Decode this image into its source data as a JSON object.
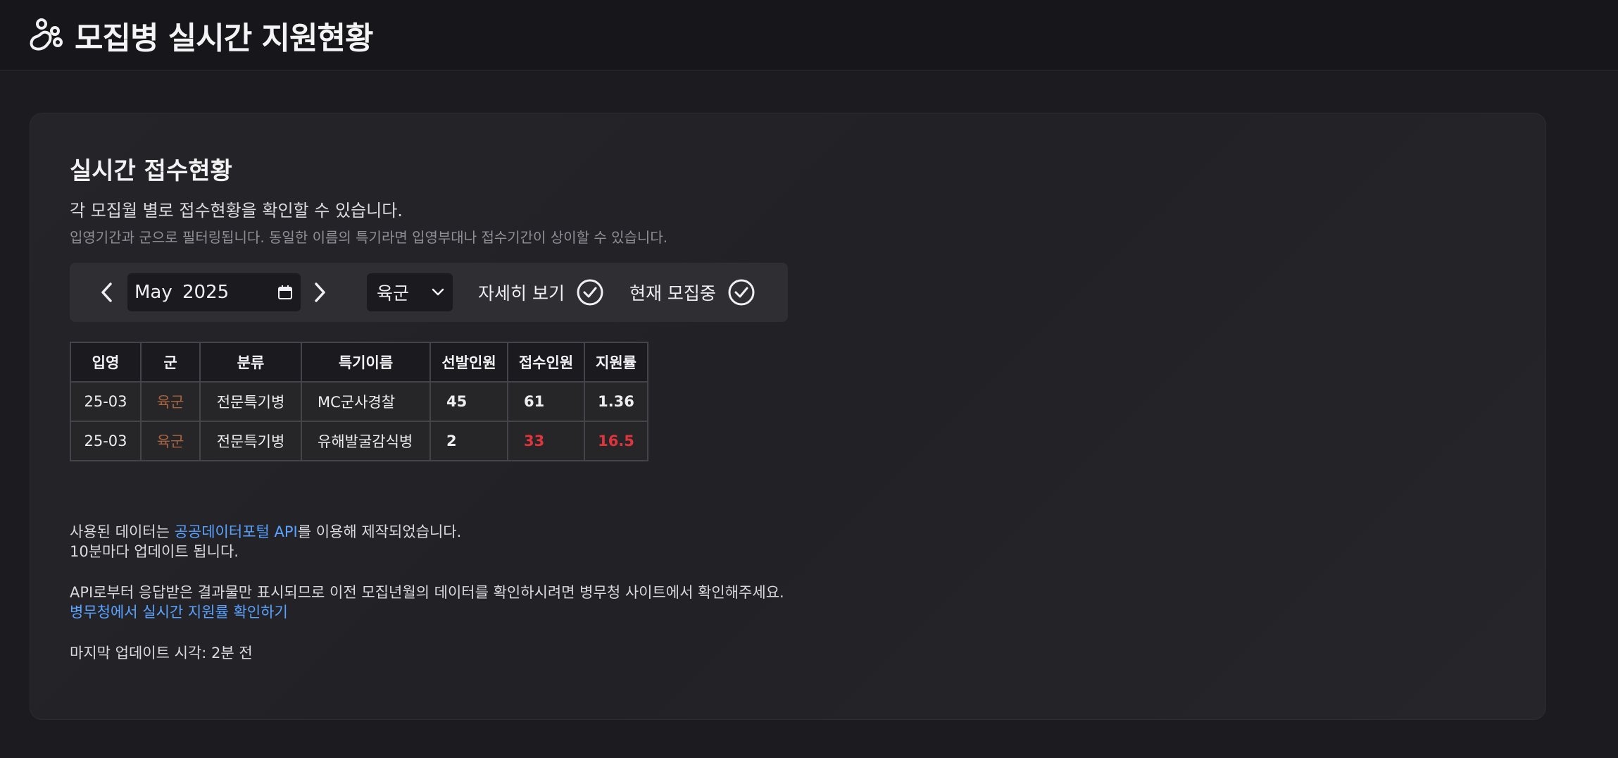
{
  "header": {
    "title": "모집병 실시간 지원현황",
    "logo_icon": "paw-icon"
  },
  "section": {
    "title": "실시간 접수현황",
    "subtitle": "각 모집월 별로 접수현황을 확인할 수 있습니다.",
    "hint": "입영기간과 군으로 필터링됩니다. 동일한 이름의 특기라면 입영부대나 접수기간이 상이할 수 있습니다."
  },
  "filters": {
    "month_value": "May 2025",
    "branch_value": "육군",
    "detail_label": "자세히 보기",
    "recruiting_label": "현재 모집중"
  },
  "table": {
    "headers": [
      "입영",
      "군",
      "분류",
      "특기이름",
      "선발인원",
      "접수인원",
      "지원률"
    ],
    "rows": [
      [
        "25-03",
        "육군",
        "전문특기병",
        "MC군사경찰",
        "45",
        "61",
        "1.36"
      ],
      [
        "25-03",
        "육군",
        "전문특기병",
        "유해발굴감식병",
        "2",
        "33",
        "16.5"
      ]
    ]
  },
  "footer": {
    "line1_prefix": "사용된 데이터는 ",
    "line1_link": "공공데이터포털 API",
    "line1_suffix": "를 이용해 제작되었습니다.",
    "line2": "10분마다 업데이트 됩니다.",
    "line3": "API로부터 응답받은 결과물만 표시되므로 이전 모집년월의 데이터를 확인하시려면 병무청 사이트에서 확인해주세요.",
    "link2": "병무청에서 실시간 지원률 확인하기",
    "last_update": "마지막 업데이트 시각: 2분 전"
  },
  "colors": {
    "link": "#5aa2ff",
    "army": "#a8643e",
    "alert": "#e0343c"
  }
}
